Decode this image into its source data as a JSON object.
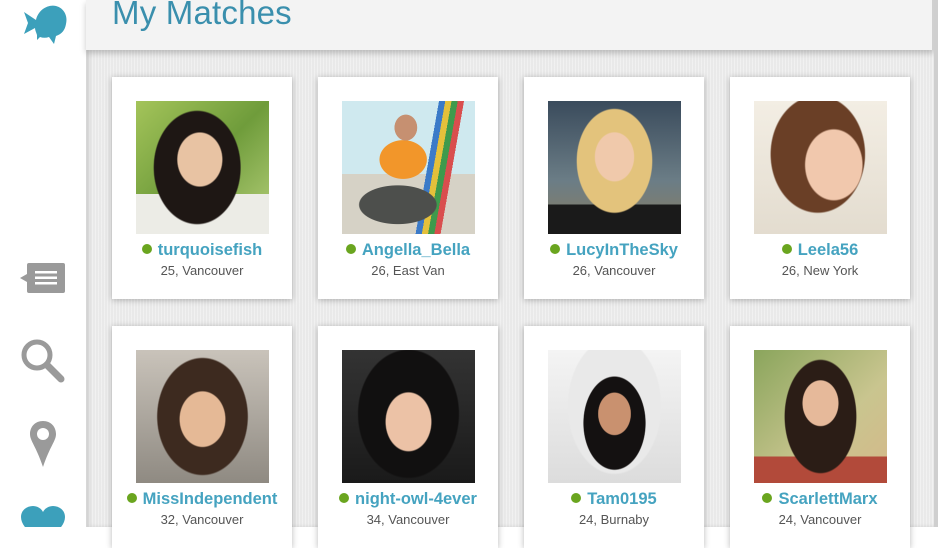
{
  "app": {
    "logo_icon": "fish-logo-icon",
    "page_title": "My Matches"
  },
  "sidebar": {
    "items": [
      {
        "name": "messages",
        "icon": "message-icon"
      },
      {
        "name": "search",
        "icon": "search-icon"
      },
      {
        "name": "location",
        "icon": "map-pin-icon"
      },
      {
        "name": "matches",
        "icon": "heart-icon"
      }
    ]
  },
  "colors": {
    "accent": "#45a3c0",
    "title": "#3a8fad",
    "online": "#6aa51f",
    "sidebar_icon": "#9a9a9a"
  },
  "matches": [
    {
      "username": "turquoisefish",
      "details": "25, Vancouver",
      "online": true
    },
    {
      "username": "Angella_Bella",
      "details": "26, East Van",
      "online": true
    },
    {
      "username": "LucyInTheSky",
      "details": "26, Vancouver",
      "online": true
    },
    {
      "username": "Leela56",
      "details": "26, New York",
      "online": true
    },
    {
      "username": "MissIndependent",
      "details": "32, Vancouver",
      "online": true
    },
    {
      "username": "night-owl-4ever",
      "details": "34, Vancouver",
      "online": true
    },
    {
      "username": "Tam0195",
      "details": "24, Burnaby",
      "online": true
    },
    {
      "username": "ScarlettMarx",
      "details": "24, Vancouver",
      "online": true
    }
  ]
}
